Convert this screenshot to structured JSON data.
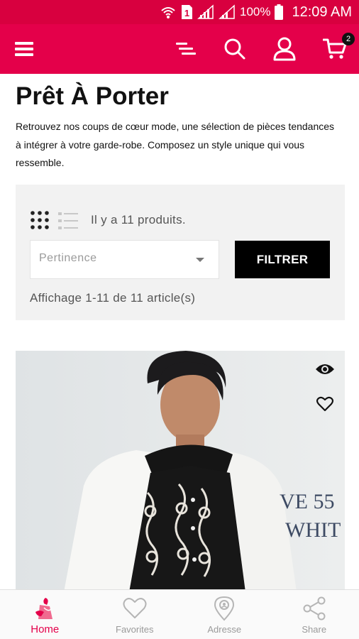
{
  "status_bar": {
    "sim_label": "1",
    "battery": "100%",
    "time": "12:09 AM"
  },
  "app_bar": {
    "icons": [
      "menu-icon",
      "sort-icon",
      "search-icon",
      "account-icon",
      "cart-icon"
    ],
    "cart_count": "2"
  },
  "page": {
    "title": "Prêt À Porter",
    "description": "Retrouvez nos coups de cœur mode, une sélection de pièces tendances à intégrer à votre garde-robe. Composez un style unique qui vous ressemble."
  },
  "filters": {
    "product_count_text": "Il y a 11 produits.",
    "sort_selected": "Pertinence",
    "filter_button_label": "FILTRER",
    "showing_text": "Affichage 1-11 de 11 article(s)"
  },
  "product_card": {
    "image_text_line1": "VE 55",
    "image_text_line2": "WHIT",
    "icons": [
      "eye-icon",
      "heart-icon"
    ]
  },
  "bottom_nav": {
    "items": [
      {
        "label": "Home",
        "icon": "home-icon",
        "active": true
      },
      {
        "label": "Favorites",
        "icon": "heart-icon",
        "active": false
      },
      {
        "label": "Adresse",
        "icon": "location-pin-icon",
        "active": false
      },
      {
        "label": "Share",
        "icon": "share-icon",
        "active": false
      }
    ]
  },
  "colors": {
    "status_bar": "#d8003f",
    "brand": "#e4004a",
    "filter_button": "#000000",
    "panel_background": "#f2f2f2"
  }
}
